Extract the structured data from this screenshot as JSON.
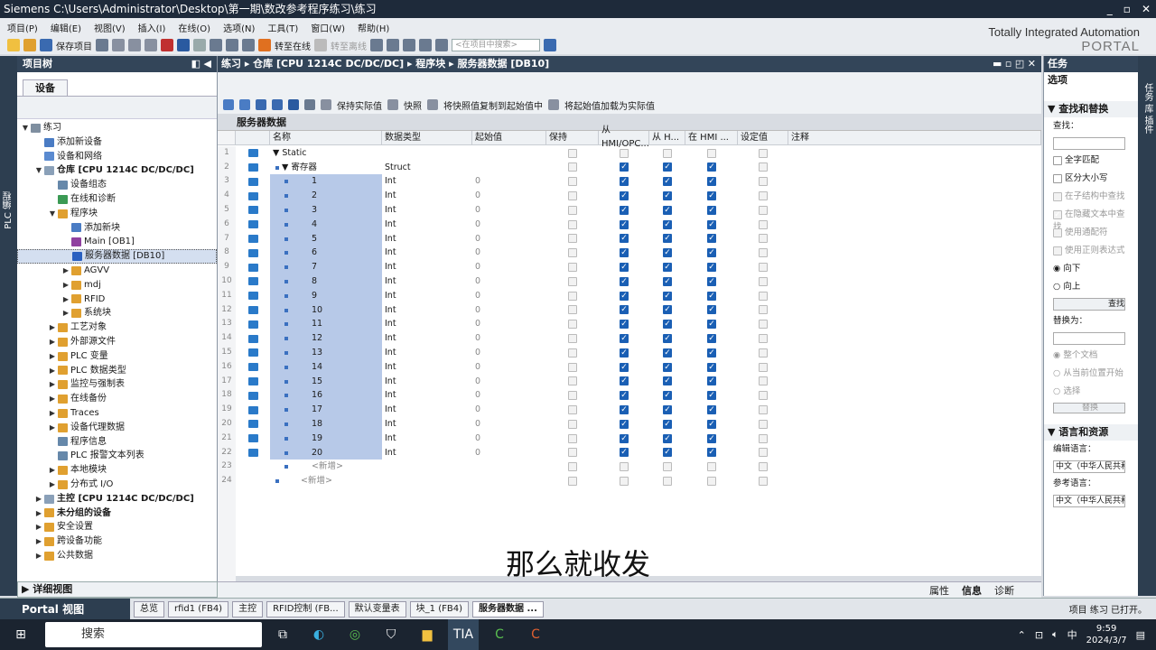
{
  "window": {
    "title": "Siemens    C:\\Users\\Administrator\\Desktop\\第一期\\数改参考程序练习\\练习"
  },
  "menu": [
    "项目(P)",
    "编辑(E)",
    "视图(V)",
    "插入(I)",
    "在线(O)",
    "选项(N)",
    "工具(T)",
    "窗口(W)",
    "帮助(H)"
  ],
  "toolbar": {
    "save": "保存项目",
    "online": "转至在线",
    "offline": "转至离线",
    "search_placeholder": "<在项目中搜索>"
  },
  "brand": {
    "line1": "Totally Integrated Automation",
    "line2": "PORTAL"
  },
  "left": {
    "vertical_tab": "PLC 编程",
    "title": "项目树",
    "devices_tab": "设备",
    "detail": "详细视图",
    "tree": [
      {
        "t": "练习",
        "d": 0,
        "e": "▼",
        "c": "#7f8fa0",
        "b": false
      },
      {
        "t": "添加新设备",
        "d": 1,
        "e": "",
        "c": "#4a7cc4",
        "b": false
      },
      {
        "t": "设备和网络",
        "d": 1,
        "e": "",
        "c": "#5a8ad0",
        "b": false
      },
      {
        "t": "仓库 [CPU 1214C DC/DC/DC]",
        "d": 1,
        "e": "▼",
        "c": "#8aa0b8",
        "b": true
      },
      {
        "t": "设备组态",
        "d": 2,
        "e": "",
        "c": "#6688aa",
        "b": false
      },
      {
        "t": "在线和诊断",
        "d": 2,
        "e": "",
        "c": "#3b9a54",
        "b": false
      },
      {
        "t": "程序块",
        "d": 2,
        "e": "▼",
        "c": "#e0a030",
        "b": false
      },
      {
        "t": "添加新块",
        "d": 3,
        "e": "",
        "c": "#4a7cc4",
        "b": false
      },
      {
        "t": "Main [OB1]",
        "d": 3,
        "e": "",
        "c": "#9040a0",
        "b": false
      },
      {
        "t": "服务器数据 [DB10]",
        "d": 3,
        "e": "",
        "c": "#2a60c0",
        "b": false,
        "sel": true
      },
      {
        "t": "AGVV",
        "d": 3,
        "e": "▶",
        "c": "#e0a030",
        "b": false
      },
      {
        "t": "mdj",
        "d": 3,
        "e": "▶",
        "c": "#e0a030",
        "b": false
      },
      {
        "t": "RFID",
        "d": 3,
        "e": "▶",
        "c": "#e0a030",
        "b": false
      },
      {
        "t": "系统块",
        "d": 3,
        "e": "▶",
        "c": "#e0a030",
        "b": false
      },
      {
        "t": "工艺对象",
        "d": 2,
        "e": "▶",
        "c": "#e0a030",
        "b": false
      },
      {
        "t": "外部源文件",
        "d": 2,
        "e": "▶",
        "c": "#e0a030",
        "b": false
      },
      {
        "t": "PLC 变量",
        "d": 2,
        "e": "▶",
        "c": "#e0a030",
        "b": false
      },
      {
        "t": "PLC 数据类型",
        "d": 2,
        "e": "▶",
        "c": "#e0a030",
        "b": false
      },
      {
        "t": "监控与强制表",
        "d": 2,
        "e": "▶",
        "c": "#e0a030",
        "b": false
      },
      {
        "t": "在线备份",
        "d": 2,
        "e": "▶",
        "c": "#e0a030",
        "b": false
      },
      {
        "t": "Traces",
        "d": 2,
        "e": "▶",
        "c": "#e0a030",
        "b": false
      },
      {
        "t": "设备代理数据",
        "d": 2,
        "e": "▶",
        "c": "#e0a030",
        "b": false
      },
      {
        "t": "程序信息",
        "d": 2,
        "e": "",
        "c": "#6688aa",
        "b": false
      },
      {
        "t": "PLC 报警文本列表",
        "d": 2,
        "e": "",
        "c": "#6688aa",
        "b": false
      },
      {
        "t": "本地模块",
        "d": 2,
        "e": "▶",
        "c": "#e0a030",
        "b": false
      },
      {
        "t": "分布式 I/O",
        "d": 2,
        "e": "▶",
        "c": "#e0a030",
        "b": false
      },
      {
        "t": "主控 [CPU 1214C DC/DC/DC]",
        "d": 1,
        "e": "▶",
        "c": "#8aa0b8",
        "b": true
      },
      {
        "t": "未分组的设备",
        "d": 1,
        "e": "▶",
        "c": "#e0a030",
        "b": true
      },
      {
        "t": "安全设置",
        "d": 1,
        "e": "▶",
        "c": "#e0a030",
        "b": false
      },
      {
        "t": "跨设备功能",
        "d": 1,
        "e": "▶",
        "c": "#e0a030",
        "b": false
      },
      {
        "t": "公共数据",
        "d": 1,
        "e": "▶",
        "c": "#e0a030",
        "b": false
      }
    ]
  },
  "editor": {
    "breadcrumb": "练习 ▸ 仓库 [CPU 1214C DC/DC/DC] ▸ 程序块 ▸ 服务器数据 [DB10]",
    "tools": [
      "保持实际值",
      "快照",
      "将快照值复制到起始值中",
      "将起始值加载为实际值"
    ],
    "name": "服务器数据",
    "columns": [
      "名称",
      "数据类型",
      "起始值",
      "保持",
      "从 HMI/OPC...",
      "从 H...",
      "在 HMI ...",
      "设定值",
      "注释"
    ],
    "static": "Static",
    "struct_name": "寄存器",
    "struct_type": "Struct",
    "int_type": "Int",
    "start": "0",
    "new": "<新增>",
    "members": [
      "1",
      "2",
      "3",
      "4",
      "5",
      "6",
      "7",
      "8",
      "9",
      "10",
      "11",
      "12",
      "13",
      "14",
      "15",
      "16",
      "17",
      "18",
      "19",
      "20"
    ]
  },
  "subtitle": "那么就收发",
  "right": {
    "title": "任务",
    "options": "选项",
    "find_replace": "查找和替换",
    "find_label": "查找：",
    "whole_word": "全字匹配",
    "match_case": "区分大小写",
    "in_struct": "在子结构中查找",
    "in_hidden": "在隐藏文本中查找",
    "wildcard": "使用通配符",
    "regex": "使用正则表达式",
    "down": "向下",
    "up": "向上",
    "find_btn": "查找",
    "replace_label": "替换为：",
    "whole_doc": "整个文档",
    "from_cur": "从当前位置开始",
    "selection": "选择",
    "replace_btn": "替换",
    "lang": "语言和资源",
    "edit_lang": "编辑语言：",
    "edit_lang_val": "中文（中华人民共和国）",
    "ref_lang": "参考语言：",
    "ref_lang_val": "中文（中华人民共和国）",
    "side_tabs": "任务  库  插件"
  },
  "bottom_tabs": [
    "属性",
    "信息",
    "诊断"
  ],
  "portal": {
    "view": "Portal 视图",
    "tabs": [
      "总览",
      "rfid1 (FB4)",
      "主控",
      "RFID控制 (FB...",
      "默认变量表",
      "块_1 (FB4)",
      "服务器数据 ..."
    ],
    "status": "项目 练习 已打开。"
  },
  "taskbar": {
    "search": "搜索",
    "time": "9:59",
    "date": "2024/3/7",
    "ime": "中"
  }
}
